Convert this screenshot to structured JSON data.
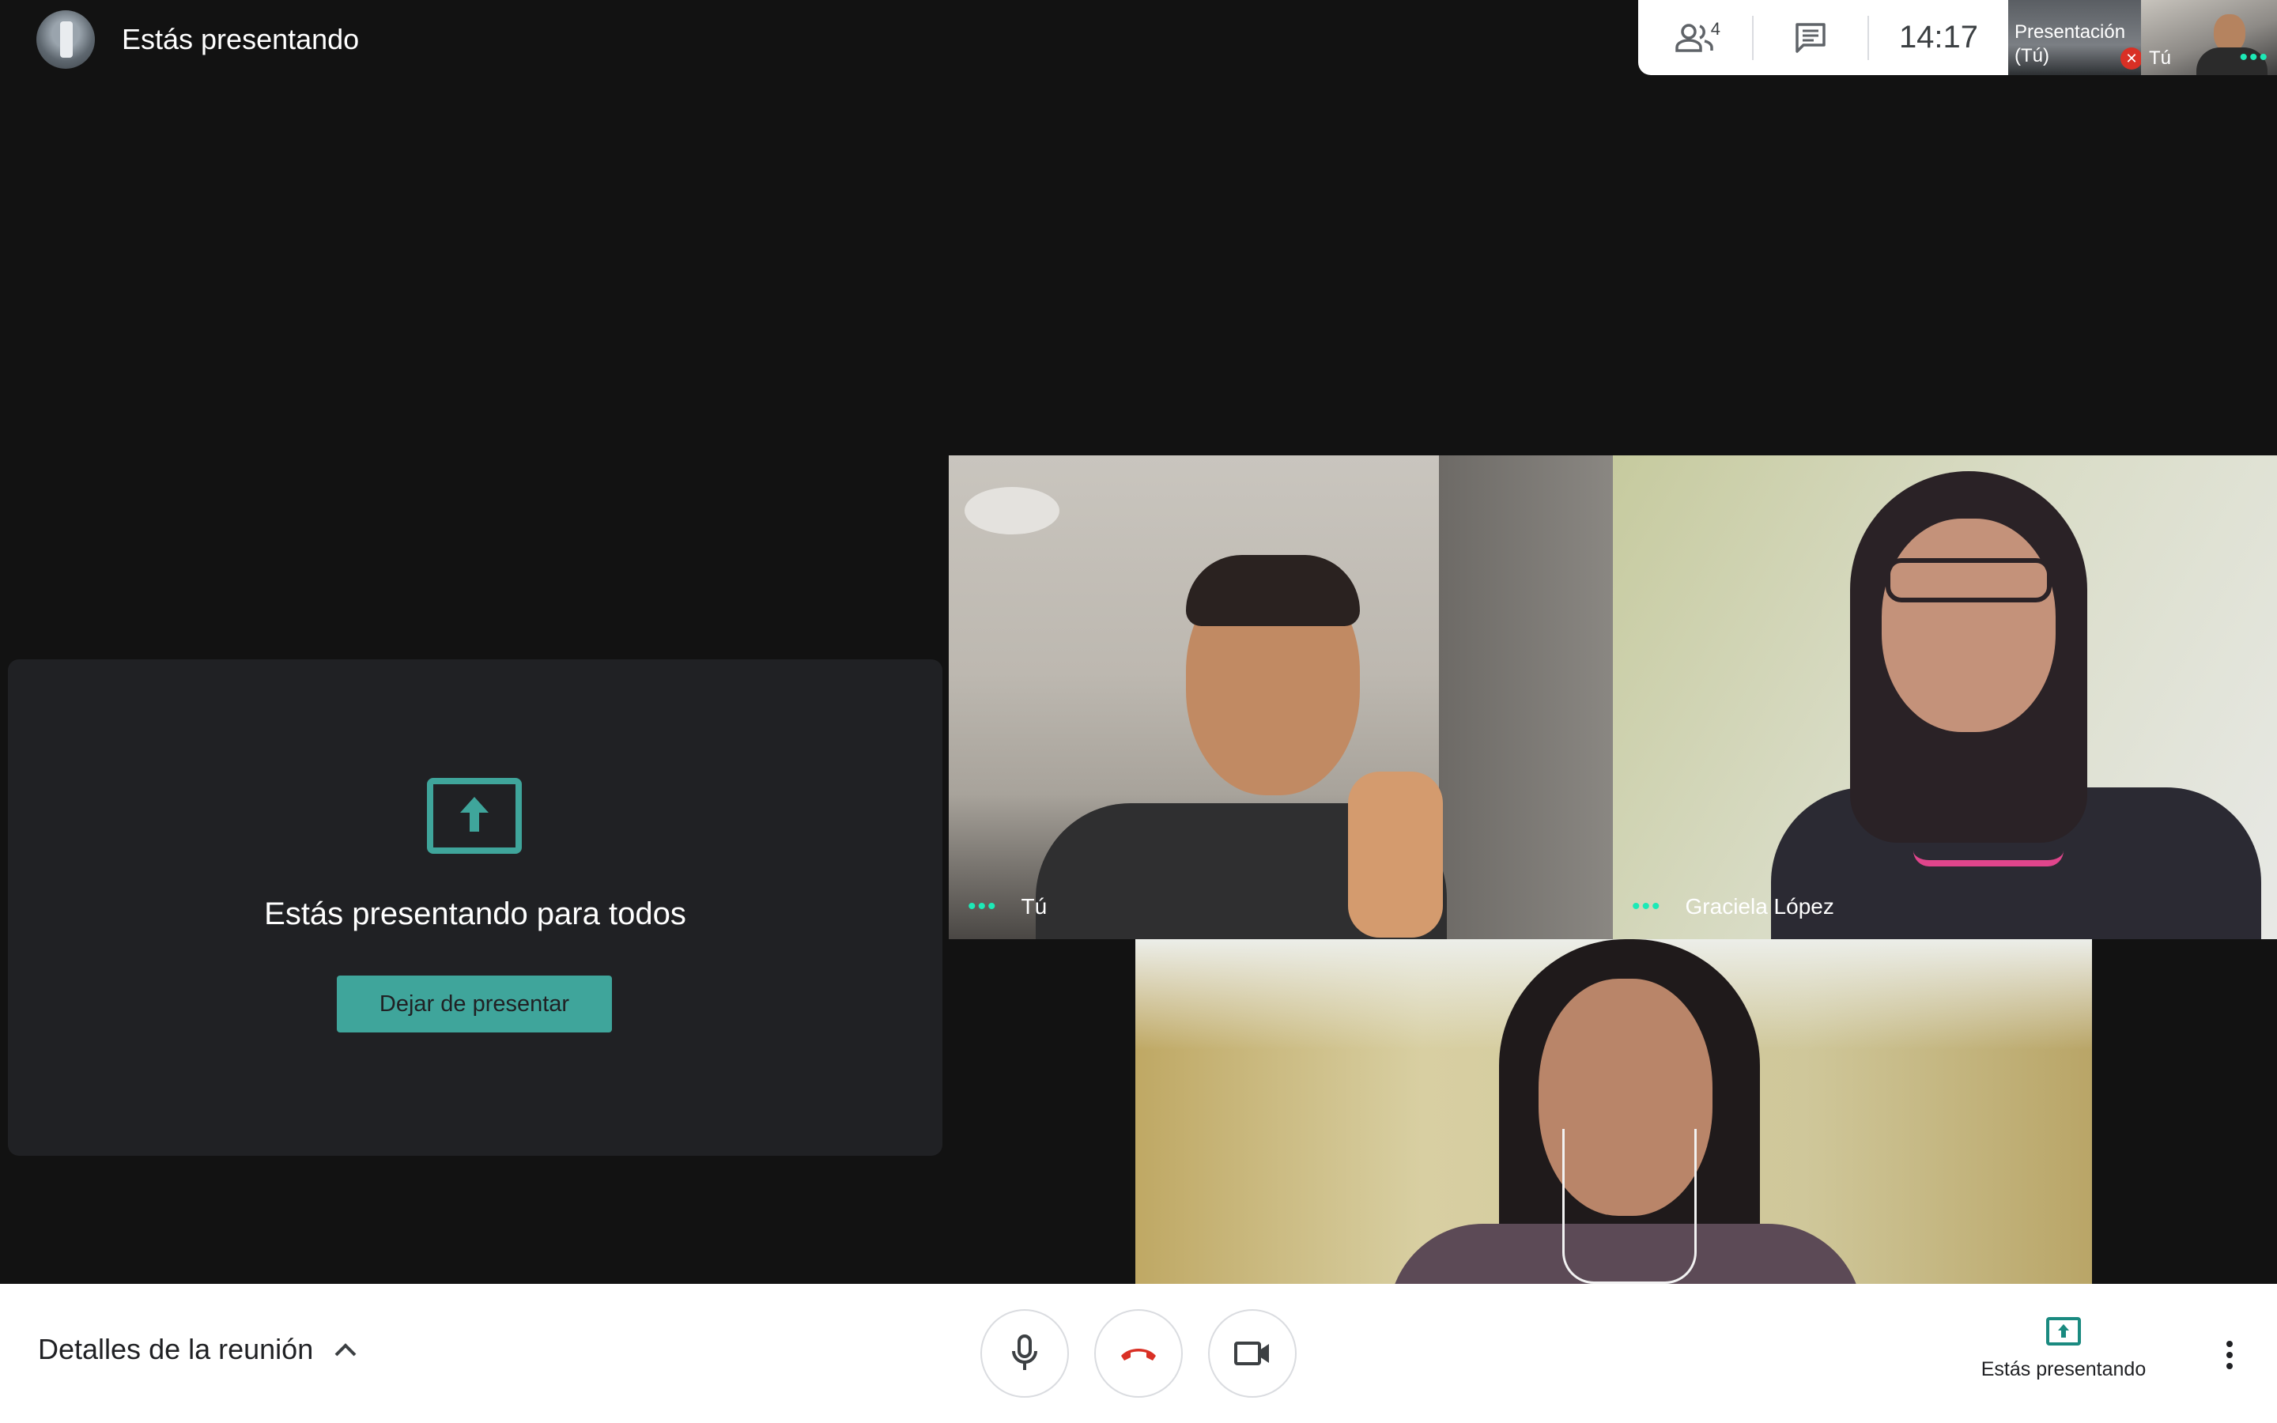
{
  "header": {
    "presenting_title": "Estás presentando"
  },
  "top_panel": {
    "participants_count": "4",
    "clock": "14:17",
    "presentation_thumb_label": "Presentación (Tú)",
    "self_thumb_label": "Tú",
    "icons": [
      "people-icon",
      "chat-icon",
      "mic-off-icon"
    ]
  },
  "present_card": {
    "message": "Estás presentando para todos",
    "stop_button": "Dejar de presentar",
    "icon": "present-to-all-icon"
  },
  "tiles": [
    {
      "name": "Tú"
    },
    {
      "name": "Graciela López"
    },
    {
      "name": ""
    }
  ],
  "bottom_bar": {
    "details_label": "Detalles de la reunión",
    "presenting_label": "Estás presentando",
    "icons": [
      "chevron-up-icon",
      "mic-icon",
      "hangup-icon",
      "camera-icon",
      "present-icon",
      "more-vert-icon"
    ]
  },
  "colors": {
    "accent_teal": "#3fa59b",
    "hangup_red": "#d93025",
    "speaking_dots": "#1de9b6",
    "background": "#121212",
    "card": "#202124"
  }
}
